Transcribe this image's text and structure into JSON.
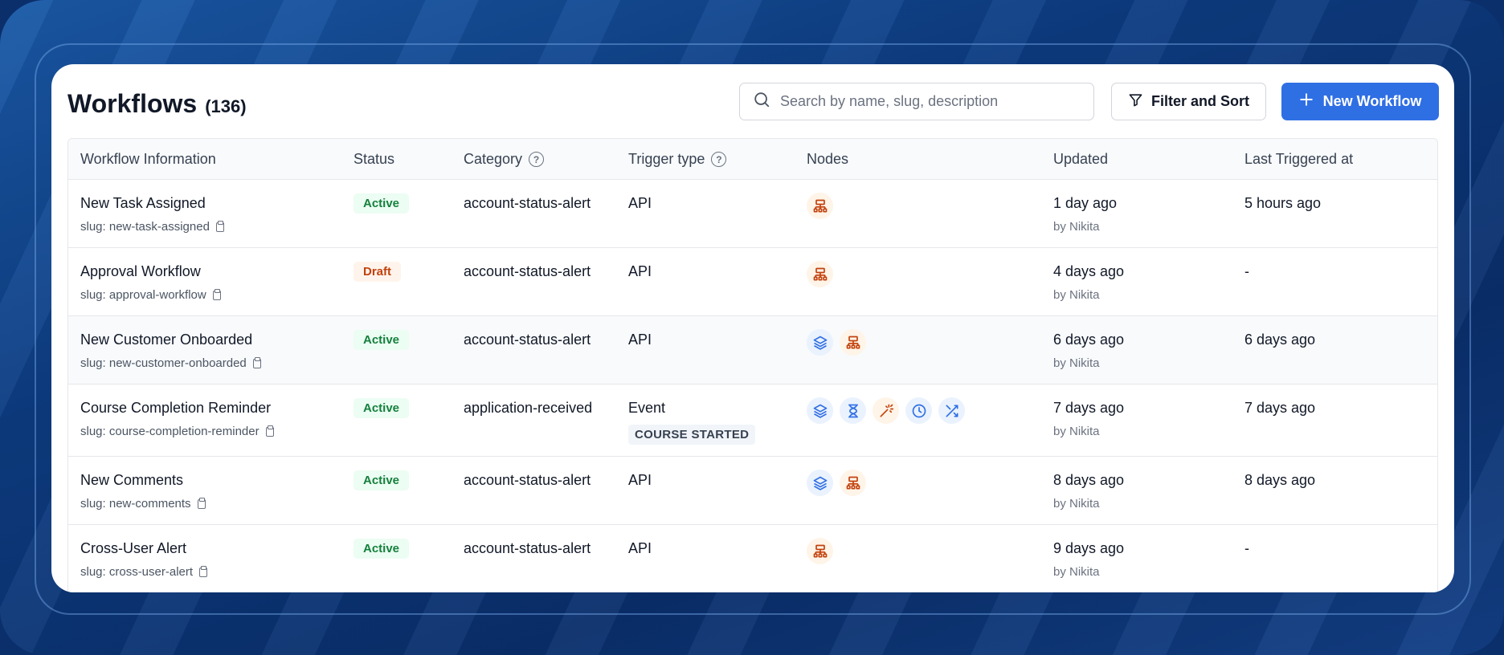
{
  "header": {
    "title": "Workflows",
    "count": "(136)",
    "search_placeholder": "Search by name, slug, description",
    "filter_label": "Filter and Sort",
    "new_label": "New Workflow"
  },
  "columns": {
    "info": "Workflow Information",
    "status": "Status",
    "category": "Category",
    "trigger": "Trigger type",
    "nodes": "Nodes",
    "updated": "Updated",
    "last": "Last Triggered at"
  },
  "rows": [
    {
      "name": "New Task Assigned",
      "slug": "slug: new-task-assigned",
      "status": "Active",
      "category": "account-status-alert",
      "trigger": "API",
      "event": "",
      "nodes": [
        "hierarchy-icon"
      ],
      "updated": "1 day ago",
      "by": "by Nikita",
      "last": "5 hours ago"
    },
    {
      "name": "Approval Workflow",
      "slug": "slug: approval-workflow",
      "status": "Draft",
      "category": "account-status-alert",
      "trigger": "API",
      "event": "",
      "nodes": [
        "hierarchy-icon"
      ],
      "updated": "4 days ago",
      "by": "by Nikita",
      "last": "-"
    },
    {
      "name": "New Customer Onboarded",
      "slug": "slug: new-customer-onboarded",
      "status": "Active",
      "category": "account-status-alert",
      "trigger": "API",
      "event": "",
      "nodes": [
        "layers-icon",
        "hierarchy-icon"
      ],
      "updated": "6 days ago",
      "by": "by Nikita",
      "last": "6 days ago"
    },
    {
      "name": "Course Completion Reminder",
      "slug": "slug: course-completion-reminder",
      "status": "Active",
      "category": "application-received",
      "trigger": "Event",
      "event": "COURSE STARTED",
      "nodes": [
        "layers-icon",
        "hourglass-icon",
        "magic-wand-icon",
        "clock-icon",
        "shuffle-icon"
      ],
      "updated": "7 days ago",
      "by": "by Nikita",
      "last": "7 days ago"
    },
    {
      "name": "New Comments",
      "slug": "slug: new-comments",
      "status": "Active",
      "category": "account-status-alert",
      "trigger": "API",
      "event": "",
      "nodes": [
        "layers-icon",
        "hierarchy-icon"
      ],
      "updated": "8 days ago",
      "by": "by Nikita",
      "last": "8 days ago"
    },
    {
      "name": "Cross-User Alert",
      "slug": "slug: cross-user-alert",
      "status": "Active",
      "category": "account-status-alert",
      "trigger": "API",
      "event": "",
      "nodes": [
        "hierarchy-icon"
      ],
      "updated": "9 days ago",
      "by": "by Nikita",
      "last": "-"
    }
  ],
  "colors": {
    "primary": "#2f6fe4",
    "active_text": "#15803d",
    "active_bg": "#ecfdf3",
    "draft_text": "#c2410c",
    "draft_bg": "#fff4ec",
    "node_blue": "#2f6fe4",
    "node_orange": "#c2410c"
  }
}
